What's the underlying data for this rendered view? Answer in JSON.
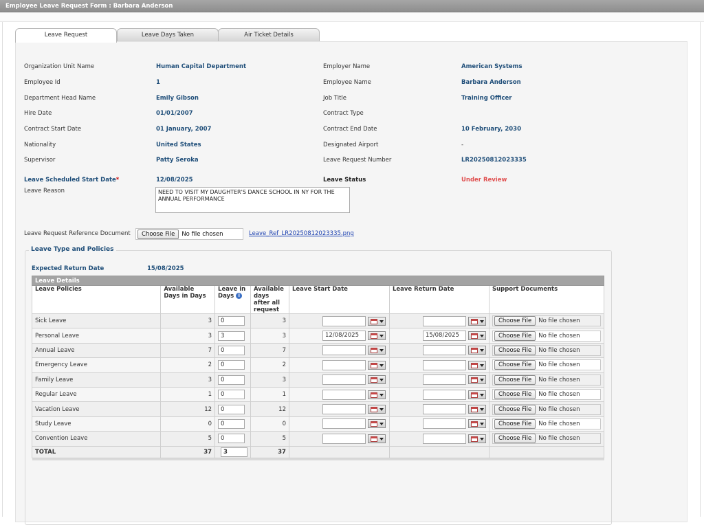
{
  "window": {
    "title": "Employee Leave Request Form : Barbara Anderson"
  },
  "tabs": [
    {
      "label": "Leave Request",
      "active": true
    },
    {
      "label": "Leave Days Taken",
      "active": false
    },
    {
      "label": "Air Ticket Details",
      "active": false
    }
  ],
  "info": {
    "org_unit_label": "Organization Unit Name",
    "org_unit_value": "Human Capital Department",
    "employer_name_label": "Employer Name",
    "employer_name_value": "American Systems",
    "employee_id_label": "Employee Id",
    "employee_id_value": "1",
    "employee_name_label": "Employee Name",
    "employee_name_value": "Barbara Anderson",
    "dept_head_label": "Department Head Name",
    "dept_head_value": "Emily Gibson",
    "job_title_label": "Job Title",
    "job_title_value": "Training Officer",
    "hire_date_label": "Hire Date",
    "hire_date_value": "01/01/2007",
    "contract_type_label": "Contract Type",
    "contract_type_value": "",
    "contract_start_label": "Contract Start Date",
    "contract_start_value": "01 January, 2007",
    "contract_end_label": "Contract End Date",
    "contract_end_value": "10 February, 2030",
    "nationality_label": "Nationality",
    "nationality_value": "United States",
    "airport_label": "Designated Airport",
    "airport_value": "-",
    "supervisor_label": "Supervisor",
    "supervisor_value": "Patty Seroka",
    "request_number_label": "Leave Request Number",
    "request_number_value": "LR20250812023335",
    "start_date_label": "Leave Scheduled Start Date",
    "required_mark": "*",
    "start_date_value": "12/08/2025",
    "status_label": "Leave Status",
    "status_value": "Under Review",
    "reason_label": "Leave Reason",
    "reason_value": "NEED TO VISIT MY DAUGHTER'S DANCE SCHOOL IN NY FOR THE ANNUAL PERFORMANCE",
    "ref_doc_label": "Leave Request Reference Document",
    "ref_doc_button": "Choose File",
    "ref_doc_status": "No file chosen",
    "ref_doc_link": "Leave_Ref_LR20250812023335.png"
  },
  "policies_section": {
    "legend": "Leave Type and Policies",
    "expected_return_label": "Expected Return Date",
    "expected_return_value": "15/08/2025",
    "table_title": "Leave Details",
    "columns": {
      "policy": "Leave Policies",
      "available": "Available Days in Days",
      "leave_in_days": "Leave in Days",
      "available_after": "Available days after all request",
      "start_date": "Leave Start Date",
      "return_date": "Leave Return Date",
      "support_docs": "Support Documents"
    },
    "choose_file_label": "Choose File",
    "no_file_label": "No file chosen",
    "rows": [
      {
        "policy": "Sick Leave",
        "available": "3",
        "leave": "0",
        "after": "3",
        "start": "",
        "return": ""
      },
      {
        "policy": "Personal Leave",
        "available": "3",
        "leave": "3",
        "after": "3",
        "start": "12/08/2025",
        "return": "15/08/2025"
      },
      {
        "policy": "Annual Leave",
        "available": "7",
        "leave": "0",
        "after": "7",
        "start": "",
        "return": ""
      },
      {
        "policy": "Emergency Leave",
        "available": "2",
        "leave": "0",
        "after": "2",
        "start": "",
        "return": ""
      },
      {
        "policy": "Family Leave",
        "available": "3",
        "leave": "0",
        "after": "3",
        "start": "",
        "return": ""
      },
      {
        "policy": "Regular Leave",
        "available": "1",
        "leave": "0",
        "after": "1",
        "start": "",
        "return": ""
      },
      {
        "policy": "Vacation Leave",
        "available": "12",
        "leave": "0",
        "after": "12",
        "start": "",
        "return": ""
      },
      {
        "policy": "Study Leave",
        "available": "0",
        "leave": "0",
        "after": "0",
        "start": "",
        "return": ""
      },
      {
        "policy": "Convention Leave",
        "available": "5",
        "leave": "0",
        "after": "5",
        "start": "",
        "return": ""
      }
    ],
    "total": {
      "label": "TOTAL",
      "available": "37",
      "leave": "3",
      "after": "37"
    }
  },
  "icons": {
    "info": "info-icon",
    "calendar": "calendar-icon",
    "dropdown": "chevron-down-icon"
  },
  "colors": {
    "label_blue": "#1f4e79",
    "status_red": "#e05050",
    "header_gray": "#a3a3a3"
  }
}
